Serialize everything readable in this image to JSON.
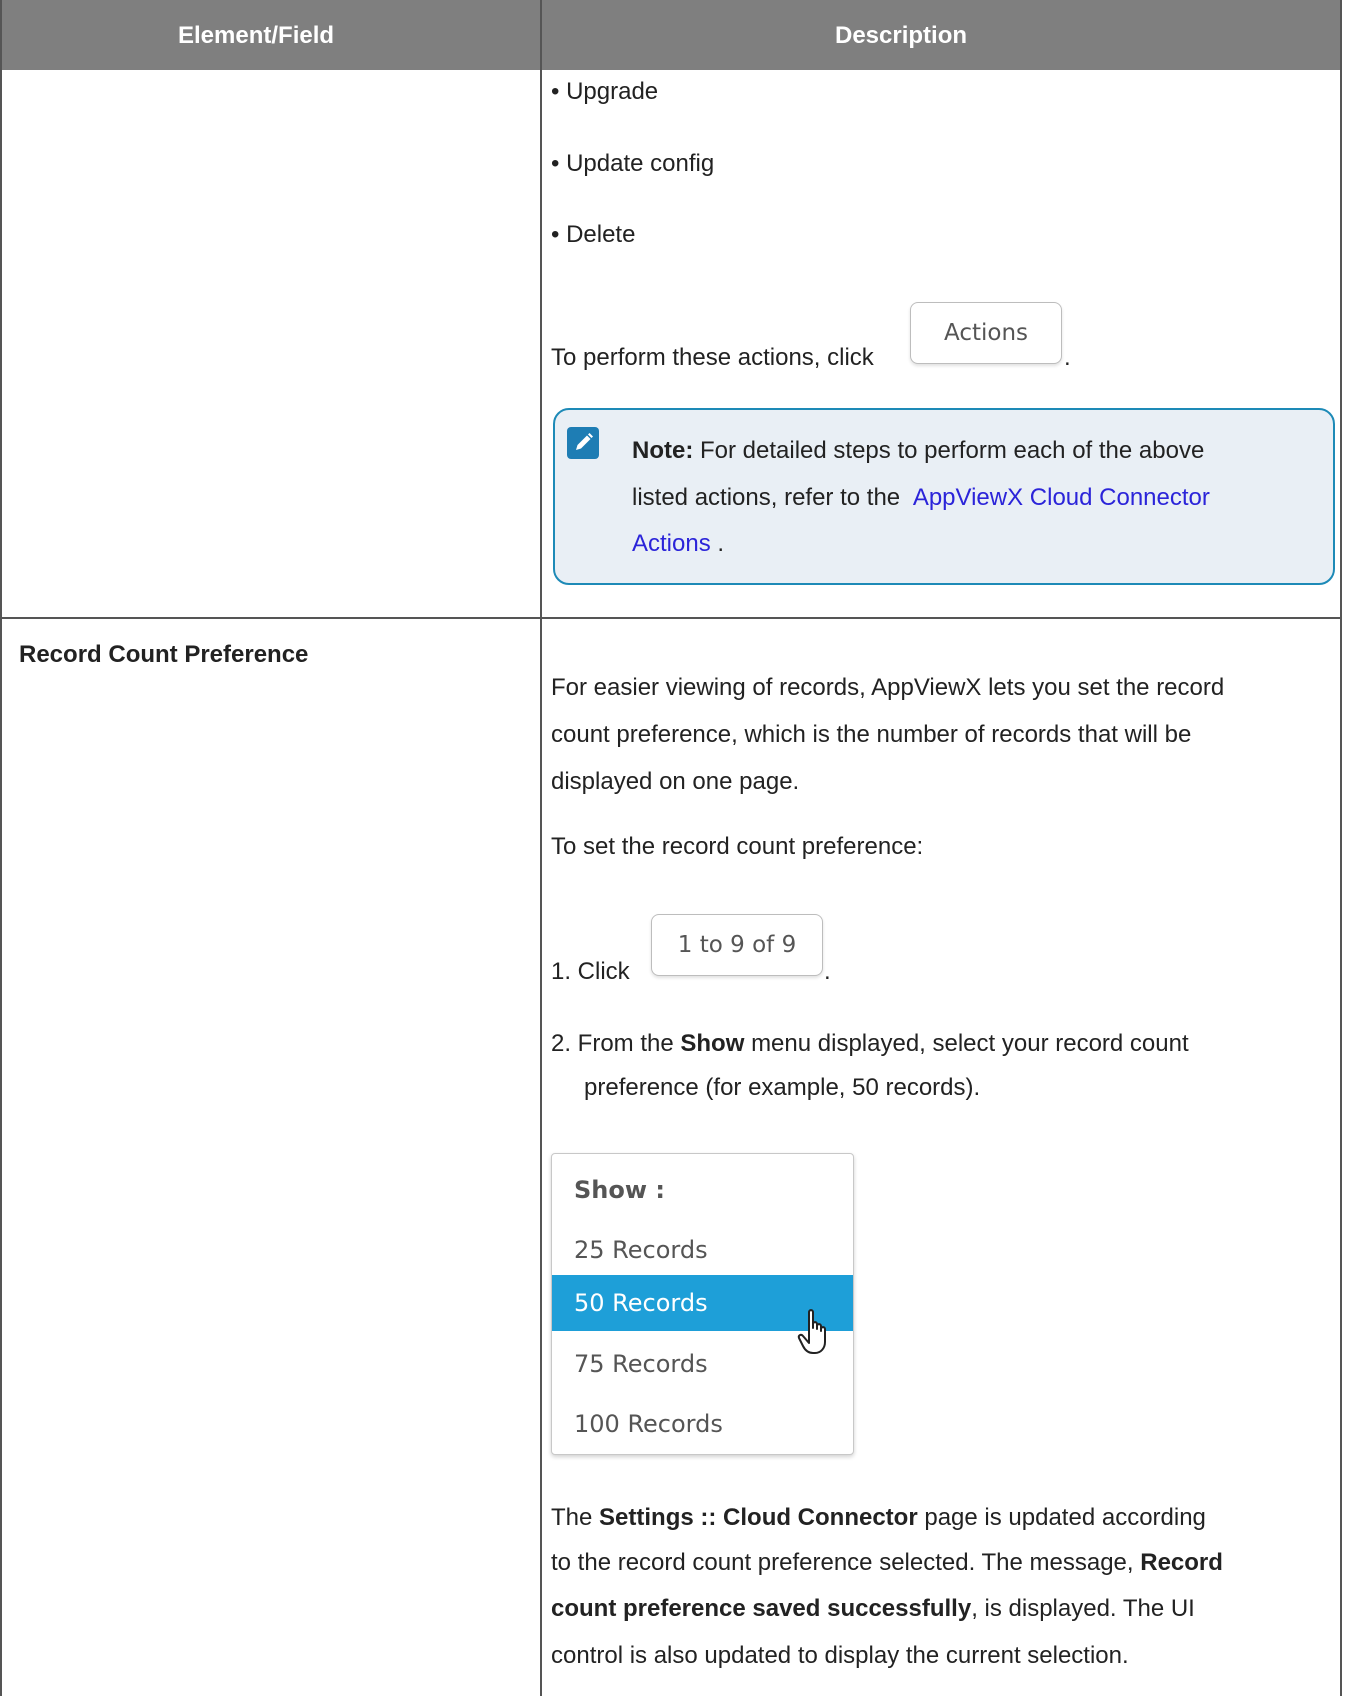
{
  "table": {
    "headers": [
      "Element/Field",
      "Description"
    ]
  },
  "row1": {
    "bullets": [
      "• Upgrade",
      "• Update config",
      "• Delete"
    ],
    "perform_text": "To perform these actions, click",
    "actions_button": "Actions",
    "period": ".",
    "note": {
      "label": "Note:",
      "line1": "For detailed steps to perform each of the above",
      "line2": "listed actions, refer to the",
      "link_line1": "AppViewX Cloud Connector",
      "link_line2": "Actions",
      "end": "."
    }
  },
  "row2": {
    "field": "Record Count Preference",
    "intro": [
      "For easier viewing of records, AppViewX lets you set the record",
      "count preference, which is the number of records that will be",
      "displayed on one page."
    ],
    "to_set": "To set the record count preference:",
    "step1_prefix": "1. Click",
    "paging_button": "1 to 9 of 9",
    "period": ".",
    "step2_pre": "2. From the",
    "step2_bold": "Show",
    "step2_post": "menu displayed, select your record count",
    "step2_line2": "preference (for example, 50 records).",
    "menu": {
      "header": "Show :",
      "items": [
        "25 Records",
        "50 Records",
        "75 Records",
        "100 Records"
      ],
      "selected": "50 Records"
    },
    "result": {
      "l1_pre": "The",
      "l1_bold": "Settings :: Cloud Connector",
      "l1_post": "page is updated according",
      "l2_pre": "to the record count preference selected. The message,",
      "l2_bold": "Record",
      "l3_bold": "count preference saved successfully",
      "l3_post": ", is displayed. The UI",
      "l4": "control is also updated to display the current selection."
    }
  },
  "colors": {
    "header_bg": "#7f7f7f",
    "link": "#2b24d9",
    "note_border": "#1d8ab7",
    "note_bg": "#e9eff5",
    "menu_selected": "#1e9fd8"
  }
}
